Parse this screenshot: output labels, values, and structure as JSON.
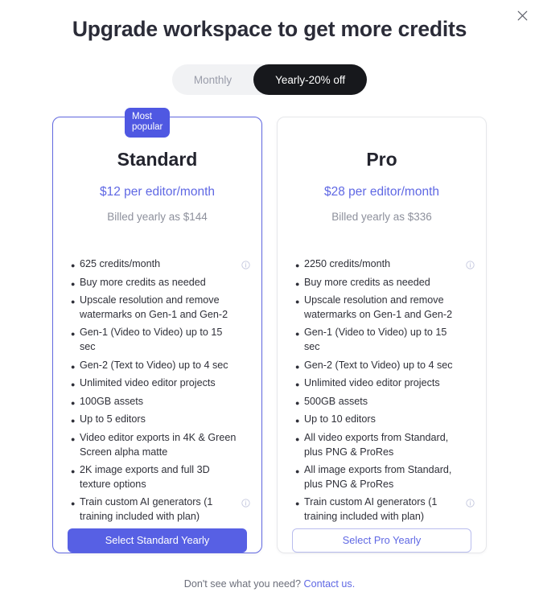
{
  "dialog": {
    "title": "Upgrade workspace to get more credits",
    "close_icon": "close-icon"
  },
  "billing_toggle": {
    "monthly_label": "Monthly",
    "yearly_label": "Yearly-20% off",
    "selected": "Yearly-20% off"
  },
  "colors": {
    "accent": "#5760e4",
    "accent_text": "#5f68e4",
    "badge_bg": "#4f58e2",
    "toggle_active_bg": "#17181c",
    "heading": "#2b2c38",
    "muted": "#8d909c"
  },
  "plans": [
    {
      "badge": "Most\npopular",
      "name": "Standard",
      "price": "$12 per editor/month",
      "billed": "Billed yearly as $144",
      "cta_label": "Select Standard Yearly",
      "cta_style": "primary",
      "features": [
        {
          "text": "625 credits/month",
          "info": true
        },
        {
          "text": "Buy more credits as needed",
          "info": false
        },
        {
          "text": "Upscale resolution and remove watermarks on Gen-1 and Gen-2",
          "info": false
        },
        {
          "text": "Gen-1 (Video to Video) up to 15 sec",
          "info": false
        },
        {
          "text": "Gen-2 (Text to Video) up to 4 sec",
          "info": false
        },
        {
          "text": "Unlimited video editor projects",
          "info": false
        },
        {
          "text": "100GB assets",
          "info": false
        },
        {
          "text": "Up to 5 editors",
          "info": false
        },
        {
          "text": "Video editor exports in 4K & Green Screen alpha matte",
          "info": false
        },
        {
          "text": "2K image exports and full 3D texture options",
          "info": false
        },
        {
          "text": "Train custom AI generators (1 training included with plan)",
          "info": true
        }
      ]
    },
    {
      "badge": null,
      "name": "Pro",
      "price": "$28 per editor/month",
      "billed": "Billed yearly as $336",
      "cta_label": "Select Pro Yearly",
      "cta_style": "secondary",
      "features": [
        {
          "text": "2250 credits/month",
          "info": true
        },
        {
          "text": "Buy more credits as needed",
          "info": false
        },
        {
          "text": "Upscale resolution and remove watermarks on Gen-1 and Gen-2",
          "info": false
        },
        {
          "text": "Gen-1 (Video to Video) up to 15 sec",
          "info": false
        },
        {
          "text": "Gen-2 (Text to Video) up to 4 sec",
          "info": false
        },
        {
          "text": "Unlimited video editor projects",
          "info": false
        },
        {
          "text": "500GB assets",
          "info": false
        },
        {
          "text": "Up to 10 editors",
          "info": false
        },
        {
          "text": "All video exports from Standard, plus PNG & ProRes",
          "info": false
        },
        {
          "text": "All image exports from Standard, plus PNG & ProRes",
          "info": false
        },
        {
          "text": "Train custom AI generators (1 training included with plan)",
          "info": true
        }
      ]
    }
  ],
  "footer": {
    "text": "Don't see what you need?",
    "link_label": "Contact us."
  }
}
